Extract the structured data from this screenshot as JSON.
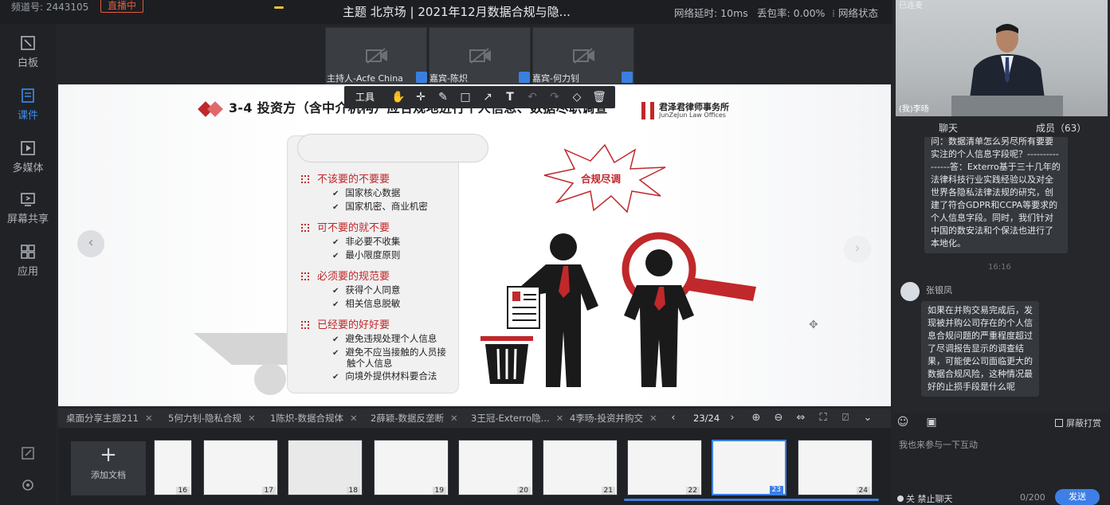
{
  "topbar": {
    "channel": "频道号: 2443105",
    "live_badge": "直播中",
    "title": "主题 北京场 | 2021年12月数据合规与隐...",
    "latency": "网络延时: 10ms",
    "packet_loss": "丢包率: 0.00%",
    "net_status": "网络状态"
  },
  "sidebar": {
    "items": [
      {
        "label": "白板",
        "icon": "whiteboard-icon"
      },
      {
        "label": "课件",
        "icon": "courseware-icon"
      },
      {
        "label": "多媒体",
        "icon": "media-icon"
      },
      {
        "label": "屏幕共享",
        "icon": "screen-share-icon"
      },
      {
        "label": "应用",
        "icon": "apps-icon"
      }
    ],
    "active": "课件"
  },
  "videos": [
    {
      "label": "主持人-Acfe China"
    },
    {
      "label": "嘉宾-陈炽"
    },
    {
      "label": "嘉宾-何力钊"
    }
  ],
  "toolbar": {
    "tools_label": "工具",
    "icons": [
      "hand-icon",
      "pointer-icon",
      "pen-icon",
      "rect-icon",
      "arrow-icon",
      "text-icon",
      "undo-icon",
      "redo-icon",
      "eraser-icon",
      "trash-icon"
    ]
  },
  "slide": {
    "title": "3-4 投资方（含中介机构）应合规地进行个人信息、数据尽职调查",
    "logo_cn": "君泽君律师事务所",
    "logo_en": "JunZeJun Law Offices",
    "burst": "合规尽调",
    "sections": [
      {
        "heading": "不该要的不要要",
        "items": [
          "国家核心数据",
          "国家机密、商业机密"
        ]
      },
      {
        "heading": "可不要的就不要",
        "items": [
          "非必要不收集",
          "最小限度原则"
        ]
      },
      {
        "heading": "必须要的规范要",
        "items": [
          "获得个人同意",
          "相关信息脱敏"
        ]
      },
      {
        "heading": "已经要的好好要",
        "items": [
          "避免违规处理个人信息",
          "避免不应当接触的人员接",
          "触个人信息",
          "向境外提供材料要合法"
        ]
      }
    ]
  },
  "tabs": [
    {
      "label": "桌面分享主题211"
    },
    {
      "label": "5何力钊-隐私合规"
    },
    {
      "label": "1陈炽-数据合规体"
    },
    {
      "label": "2薛颖-数据反垄断"
    },
    {
      "label": "3王冠-Exterro隐..."
    },
    {
      "label": "4李旸-投资并购交"
    }
  ],
  "pager": "23/24",
  "thumbs": {
    "add_label": "添加文档",
    "pages": [
      "16",
      "17",
      "18",
      "19",
      "20",
      "21",
      "22",
      "23",
      "24"
    ],
    "selected": "23"
  },
  "right": {
    "cam_tag": "已连麦",
    "cam_name": "(我)李旸",
    "tab_chat": "聊天",
    "tab_members": "成员（63）",
    "msg1": "问：数据清单怎么另尽所有要要实注的个人信息字段呢？----------------答：Exterro基于三十几年的法律科技行业实践经验以及对全世界各隐私法律法规的研究，创建了符合GDPR和CCPA等要求的个人信息字段。同时，我们针对中国的数安法和个保法也进行了本地化。",
    "time": "16:16",
    "user2": "张银凤",
    "msg2": "如果在并购交易完成后，发现被并购公司存在的个人信息合规问题的严重程度超过了尽调报告显示的调查结果，可能使公司面临更大的数据合规风险，这种情况最好的止损手段是什么呢",
    "shield_label": "屏蔽打赏",
    "placeholder": "我也来参与一下互动",
    "mute_label": "关 禁止聊天",
    "counter": "0/200",
    "send": "发送"
  }
}
